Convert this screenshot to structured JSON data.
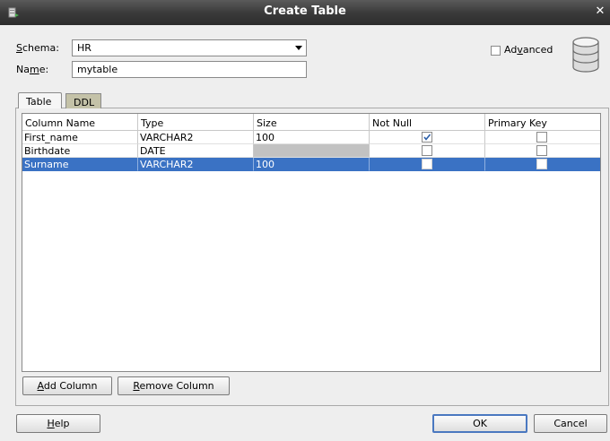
{
  "window": {
    "title": "Create Table"
  },
  "form": {
    "schema_label_key": "S",
    "schema_label_rest": "chema:",
    "schema_value": "HR",
    "name_label_pre": "Na",
    "name_label_key": "m",
    "name_label_rest": "e:",
    "name_value": "mytable",
    "advanced_pre": "Ad",
    "advanced_key": "v",
    "advanced_rest": "anced"
  },
  "tabs": [
    {
      "label": "Table",
      "active": true
    },
    {
      "label": "DDL",
      "active": false
    }
  ],
  "table": {
    "headers": [
      "Column Name",
      "Type",
      "Size",
      "Not Null",
      "Primary Key"
    ],
    "rows": [
      {
        "column_name": "First_name",
        "type": "VARCHAR2",
        "size": "100",
        "not_null": true,
        "primary_key": false,
        "selected": false
      },
      {
        "column_name": "Birthdate",
        "type": "DATE",
        "size": "",
        "not_null": false,
        "primary_key": false,
        "selected": false
      },
      {
        "column_name": "Surname",
        "type": "VARCHAR2",
        "size": "100",
        "not_null": false,
        "primary_key": false,
        "selected": true
      }
    ]
  },
  "buttons": {
    "add_column_key": "A",
    "add_column_rest": "dd Column",
    "remove_column_key": "R",
    "remove_column_rest": "emove Column",
    "help_key": "H",
    "help_rest": "elp",
    "ok": "OK",
    "cancel": "Cancel"
  },
  "colors": {
    "selection": "#3a72c4",
    "titlebar": "#3b3b3b",
    "inactive_tab": "#c4c2a8"
  },
  "icons": {
    "app": "database-app-icon",
    "close": "close-icon",
    "database": "database-icon"
  }
}
